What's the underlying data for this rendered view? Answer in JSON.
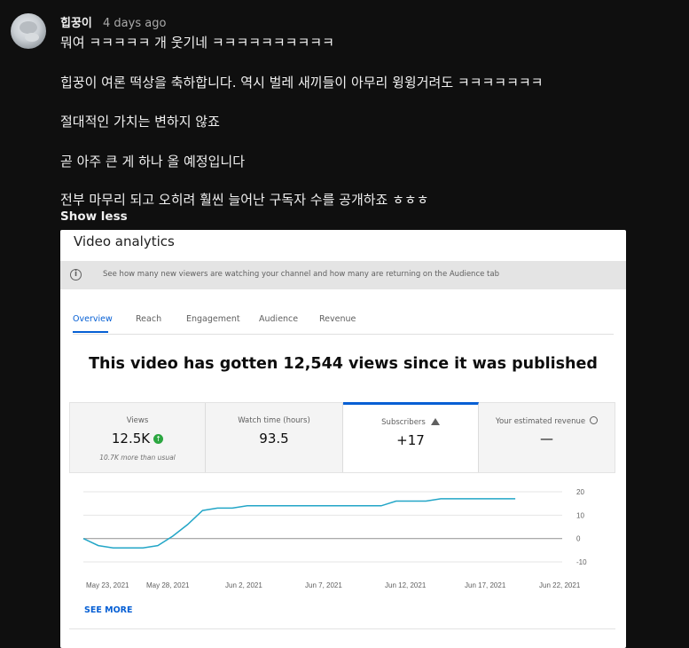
{
  "comment": {
    "author": "힙꿍이",
    "time": "4 days ago",
    "lines": [
      "뭐여 ㅋㅋㅋㅋㅋ 개 웃기네 ㅋㅋㅋㅋㅋㅋㅋㅋㅋㅋ",
      "힙꿍이 여론 떡상을 축하합니다. 역시 벌레 새끼들이 아무리 윙윙거려도 ㅋㅋㅋㅋㅋㅋㅋ",
      "절대적인 가치는 변하지 않죠",
      "곧 아주 큰 게 하나 올 예정입니다",
      "전부 마무리 되고 오히려 훨씬 늘어난 구독자 수를 공개하죠 ㅎㅎㅎ"
    ],
    "show_less": "Show less"
  },
  "analytics": {
    "title": "Video analytics",
    "info": "See how many new viewers are watching your channel and how many are returning on the Audience tab",
    "tabs": [
      "Overview",
      "Reach",
      "Engagement",
      "Audience",
      "Revenue"
    ],
    "active_tab": "Overview",
    "headline": "This video has gotten 12,544 views since it was published",
    "cards": [
      {
        "label": "Views",
        "value": "12.5K",
        "sub": "10.7K more than usual"
      },
      {
        "label": "Watch time (hours)",
        "value": "93.5",
        "sub": ""
      },
      {
        "label": "Subscribers",
        "value": "+17",
        "sub": ""
      },
      {
        "label": "Your estimated revenue",
        "value": "—",
        "sub": ""
      }
    ],
    "see_more": "SEE MORE"
  },
  "colors": {
    "accent": "#065fd4",
    "line": "#23a6c7",
    "up": "#2ba640"
  },
  "chart_data": {
    "type": "line",
    "x": [
      "May 21",
      "May 22",
      "May 23",
      "May 24",
      "May 25",
      "May 26",
      "May 27",
      "May 28",
      "May 29",
      "May 30",
      "May 31",
      "Jun 1",
      "Jun 2",
      "Jun 3",
      "Jun 4",
      "Jun 5",
      "Jun 6",
      "Jun 7",
      "Jun 8",
      "Jun 9",
      "Jun 10",
      "Jun 11",
      "Jun 12",
      "Jun 13",
      "Jun 14",
      "Jun 15",
      "Jun 16",
      "Jun 17",
      "Jun 18",
      "Jun 19"
    ],
    "values": [
      0,
      -3,
      -4,
      -4,
      -4,
      -3,
      1,
      6,
      12,
      13,
      13,
      14,
      14,
      14,
      14,
      14,
      14,
      14,
      14,
      14,
      14,
      16,
      16,
      16,
      17,
      17,
      17,
      17,
      17,
      17
    ],
    "xticks": [
      "May 23, 2021",
      "May 28, 2021",
      "Jun 2, 2021",
      "Jun 7, 2021",
      "Jun 12, 2021",
      "Jun 17, 2021",
      "Jun 22, 2021"
    ],
    "yticks": [
      "20",
      "10",
      "0",
      "-10"
    ],
    "ylim": [
      -10,
      20
    ]
  }
}
